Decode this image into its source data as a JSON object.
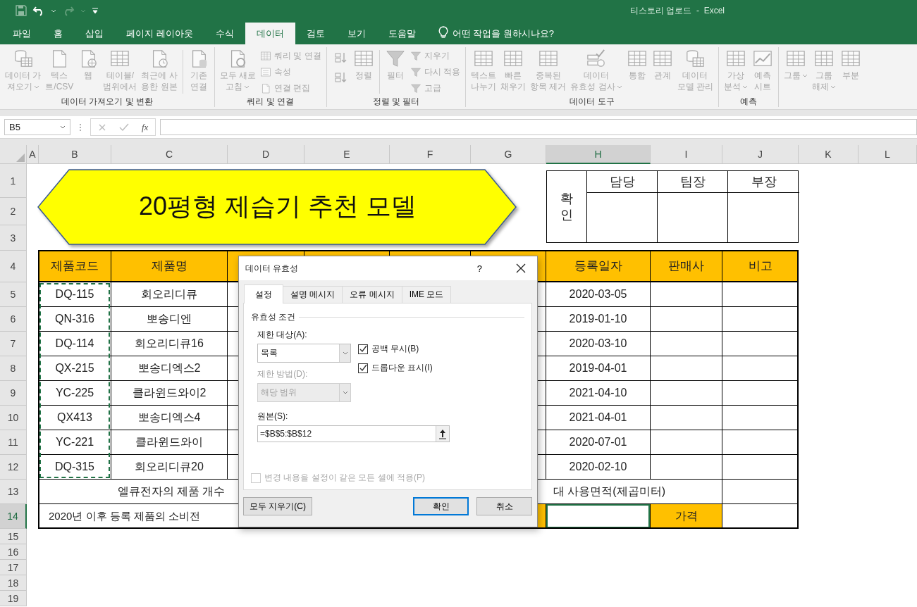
{
  "title_bar": {
    "title": "티스토리 업로드  -  Excel",
    "redo_disabled": true
  },
  "menu_tabs": [
    {
      "label": "파일",
      "selected": false
    },
    {
      "label": "홈",
      "selected": false
    },
    {
      "label": "삽입",
      "selected": false
    },
    {
      "label": "페이지 레이아웃",
      "selected": false
    },
    {
      "label": "수식",
      "selected": false
    },
    {
      "label": "데이터",
      "selected": true
    },
    {
      "label": "검토",
      "selected": false
    },
    {
      "label": "보기",
      "selected": false
    },
    {
      "label": "도움말",
      "selected": false
    }
  ],
  "tell_me": {
    "placeholder": "어떤 작업을 원하시나요?"
  },
  "ribbon": {
    "disabled": true,
    "groups": [
      {
        "label": "데이터 가져오기 및 변환",
        "items": [
          {
            "kind": "large",
            "lines": [
              "데이터 가",
              "져오기"
            ],
            "dropdown": true
          },
          {
            "kind": "large",
            "lines": [
              "텍스",
              "트/CSV"
            ],
            "dropdown": false
          },
          {
            "kind": "large",
            "lines": [
              "웹"
            ],
            "dropdown": false
          },
          {
            "kind": "large",
            "lines": [
              "테이블/",
              "범위에서"
            ],
            "dropdown": false
          },
          {
            "kind": "large",
            "lines": [
              "최근에 사",
              "용한 원본"
            ],
            "dropdown": false
          },
          {
            "kind": "separator"
          },
          {
            "kind": "large",
            "lines": [
              "기존",
              "연결"
            ],
            "dropdown": false
          }
        ]
      },
      {
        "label": "쿼리 및 연결",
        "items": [
          {
            "kind": "large",
            "lines": [
              "모두 새로",
              "고침"
            ],
            "dropdown": true
          },
          {
            "kind": "stack",
            "items": [
              "쿼리 및 연결",
              "속성",
              "연결 편집"
            ]
          }
        ]
      },
      {
        "label": "정렬 및 필터",
        "items": [
          {
            "kind": "sort"
          },
          {
            "kind": "large",
            "lines": [
              "정렬"
            ],
            "dropdown": false
          },
          {
            "kind": "separator"
          },
          {
            "kind": "large",
            "lines": [
              "필터"
            ],
            "dropdown": false
          },
          {
            "kind": "stack",
            "items": [
              "지우기",
              "다시 적용",
              "고급"
            ]
          }
        ]
      },
      {
        "label": "데이터 도구",
        "items": [
          {
            "kind": "large",
            "lines": [
              "텍스트",
              "나누기"
            ],
            "dropdown": false
          },
          {
            "kind": "large",
            "lines": [
              "빠른",
              "채우기"
            ],
            "dropdown": false
          },
          {
            "kind": "large",
            "lines": [
              "중복된",
              "항목 제거"
            ],
            "dropdown": false
          },
          {
            "kind": "large",
            "lines": [
              "데이터",
              "유효성 검사"
            ],
            "dropdown": true
          },
          {
            "kind": "large",
            "lines": [
              "통합"
            ],
            "dropdown": false
          },
          {
            "kind": "large",
            "lines": [
              "관계"
            ],
            "dropdown": false
          },
          {
            "kind": "large",
            "lines": [
              "데이터",
              "모델 관리"
            ],
            "dropdown": false
          }
        ]
      },
      {
        "label": "예측",
        "items": [
          {
            "kind": "large",
            "lines": [
              "가상",
              "분석"
            ],
            "dropdown": true
          },
          {
            "kind": "large",
            "lines": [
              "예측",
              "시트"
            ],
            "dropdown": false
          }
        ]
      },
      {
        "kind": "cut",
        "items": [
          {
            "kind": "large",
            "lines": [
              "그룹"
            ],
            "dropdown": true
          },
          {
            "kind": "large",
            "lines": [
              "그룹",
              "해제"
            ],
            "dropdown": true
          },
          {
            "kind": "large",
            "lines": [
              "부분"
            ],
            "dropdown": false
          }
        ]
      }
    ]
  },
  "formula_bar": {
    "name_box": "B5",
    "function_button": "fx"
  },
  "columns": [
    {
      "label": "A",
      "selected": false
    },
    {
      "label": "B",
      "selected": false
    },
    {
      "label": "C",
      "selected": false
    },
    {
      "label": "D",
      "selected": false
    },
    {
      "label": "E",
      "selected": false
    },
    {
      "label": "F",
      "selected": false
    },
    {
      "label": "G",
      "selected": false
    },
    {
      "label": "H",
      "selected": true
    },
    {
      "label": "I",
      "selected": false
    },
    {
      "label": "J",
      "selected": false
    },
    {
      "label": "K",
      "selected": false
    },
    {
      "label": "L",
      "selected": false
    }
  ],
  "rows": [
    {
      "label": "1",
      "selected": false
    },
    {
      "label": "2",
      "selected": false
    },
    {
      "label": "3",
      "selected": false
    },
    {
      "label": "4",
      "selected": false
    },
    {
      "label": "5",
      "selected": false
    },
    {
      "label": "6",
      "selected": false
    },
    {
      "label": "7",
      "selected": false
    },
    {
      "label": "8",
      "selected": false
    },
    {
      "label": "9",
      "selected": false
    },
    {
      "label": "10",
      "selected": false
    },
    {
      "label": "11",
      "selected": false
    },
    {
      "label": "12",
      "selected": false
    },
    {
      "label": "13",
      "selected": false
    },
    {
      "label": "14",
      "selected": true
    },
    {
      "label": "15",
      "selected": false
    },
    {
      "label": "16",
      "selected": false
    },
    {
      "label": "17",
      "selected": false
    },
    {
      "label": "18",
      "selected": false
    },
    {
      "label": "19",
      "selected": false
    }
  ],
  "banner": {
    "title": "20평형 제습기 추천 모델"
  },
  "approval": {
    "label": "확인",
    "roles": [
      "담당",
      "팀장",
      "부장"
    ]
  },
  "table_header": {
    "code": "제품코드",
    "name": "제품명",
    "date": "등록일자",
    "seller": "판매사",
    "note": "비고"
  },
  "products": [
    {
      "code": "DQ-115",
      "name": "회오리디큐",
      "date": "2020-03-05"
    },
    {
      "code": "QN-316",
      "name": "뽀송디엔",
      "date": "2019-01-10"
    },
    {
      "code": "DQ-114",
      "name": "회오리디큐16",
      "date": "2020-03-10"
    },
    {
      "code": "QX-215",
      "name": "뽀송디엑스2",
      "date": "2019-04-01"
    },
    {
      "code": "YC-225",
      "name": "클라윈드와이2",
      "date": "2021-04-10"
    },
    {
      "code": "QX413",
      "name": "뽀송디엑스4",
      "date": "2021-04-01"
    },
    {
      "code": "YC-221",
      "name": "클라윈드와이",
      "date": "2020-07-01"
    },
    {
      "code": "DQ-315",
      "name": "회오리디큐20",
      "date": "2020-02-10"
    }
  ],
  "summary": {
    "count_label": "엘큐전자의 제품 개수",
    "max_area_label": "대 사용면적(제곱미터)",
    "power_label": "2020년 이후 등록 제품의 소비전",
    "price_label": "가격",
    "answer_selected": true
  },
  "dialog": {
    "title": "데이터 유효성",
    "help": "?",
    "tabs": [
      {
        "label": "설정",
        "selected": true
      },
      {
        "label": "설명 메시지",
        "selected": false
      },
      {
        "label": "오류 메시지",
        "selected": false
      },
      {
        "label": "IME 모드",
        "selected": false
      }
    ],
    "section": "유효성 조건",
    "allow": {
      "label": "제한 대상(A):",
      "value": "목록",
      "disabled": false
    },
    "data_op": {
      "label": "제한 방법(D):",
      "value": "해당 범위",
      "disabled": true
    },
    "checkboxes": [
      {
        "label": "공백 무시(B)",
        "checked": true
      },
      {
        "label": "드롭다운 표시(I)",
        "checked": true
      }
    ],
    "source": {
      "label": "원본(S):",
      "value": "=$B$5:$B$12"
    },
    "apply_all": {
      "label": "변경 내용을 설정이 같은 모든 셀에 적용(P)",
      "checked": false,
      "disabled": true
    },
    "buttons": [
      {
        "label": "모두 지우기(C)",
        "kind": "clear"
      },
      {
        "label": "확인",
        "kind": "default"
      },
      {
        "label": "취소",
        "kind": "cancel"
      }
    ]
  }
}
